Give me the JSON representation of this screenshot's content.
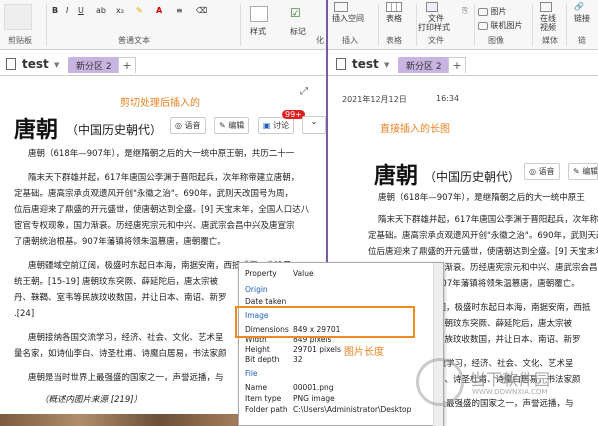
{
  "left_ribbon": {
    "clipboard": "剪贴板",
    "font_group": "普通文本",
    "styles": "样式",
    "tags": "标记",
    "last_cut": "化"
  },
  "right_ribbon": {
    "insert_space": "插入空间",
    "table": "表格",
    "file_printout": "文件\n打印样式",
    "file_printout_l1": "文件",
    "file_printout_l2": "打印样式",
    "picture": "图片",
    "online_picture": "联机图片",
    "online_video": "在线\n视频",
    "online_video_l1": "在线",
    "online_video_l2": "视频",
    "link": "链接",
    "groups": {
      "insert": "插入",
      "tables": "表格",
      "file": "文件",
      "images": "图像",
      "media": "媒体",
      "links": "链"
    }
  },
  "tabs": {
    "notebook": "test",
    "section": "新分区 2",
    "add": "+"
  },
  "left_page": {
    "annotation": "剪切处理后插入的",
    "title": "唐朝",
    "subtitle": "（中国历史朝代）",
    "btn_audio": "语音",
    "btn_edit": "编辑",
    "btn_discuss": "讨论",
    "badge": "99+",
    "lines": [
      "唐朝（618年—907年），是继隋朝之后的大一统中原王朝，共历二十一",
      "隋末天下群雄并起，617年唐国公李渊于晋阳起兵，次年称帝建立唐朝，",
      "定基础。唐高宗承贞观遗风开创\"永徽之治\"。690年，武则天改国号为周，",
      "位后唐迎来了鼎盛的开元盛世，使唐朝达到全盛。[9]  天宝末年，全国人口达八",
      "宦官专权现象，国力渐衰。历经唐宪宗元和中兴、唐武宗会昌中兴及唐宣宗",
      "了唐朝统治根基。907年藩镇将领朱温篡唐，唐朝覆亡。",
      "唐朝疆域空前辽阔，极盛时东起日本海，南据安南，西抵咸海，北逾贝",
      "统王朝。[15-19]  唐朝玟东突厥、薛延陀后，唐太宗被",
      "丹、靺鞨、室韦等民族玟收数国，并让日本、南诏、新罗",
      ".[24]",
      "唐朝接纳各国交流学习，经济、社会、文化、艺术呈",
      "量名家，如诗仙李白、诗圣杜甫、诗魔白居易，书法家颜",
      "唐朝是当时世界上最强盛的国家之一，声誉远播，与",
      "（概述内图片来源 [219]）"
    ]
  },
  "right_page": {
    "date": "2021年12月12日",
    "time": "16:34",
    "annotation": "直接插入的长图",
    "title": "唐朝",
    "subtitle": "（中国历史朝代）",
    "btn_audio": "语音",
    "btn_edit": "编辑",
    "annotation2": "图片长度",
    "lines": [
      "唐朝（618年—907年），是继隋朝之后的大一统中原王",
      "隋末天下群雄并起，617年唐国公李渊于晋阳起兵，次年称帝建",
      "定基础。唐高宗承贞观遗风开创\"永徽之治\"。690年，武则天改国",
      "位后唐迎来了鼎盛的开元盛世，使唐朝达到全盛。[9]  天宝末年，全",
      "宦官专权现象，国力渐衰。历经唐宪宗元和中兴、唐武宗会昌中兴",
      "了唐朝统治根基。907年藩镇将领朱温篡唐，唐朝覆亡。",
      "唐朝疆域空前辽阔，极盛时东起日本海，南据安南，西抵",
      "统王朝。[15-19]  唐朝玟东突厥、薛延陀后，唐太宗被",
      "丹、靺鞨、室韦等民族玟收数国，并让日本、南诏、新罗",
      "唐朝接纳各国交流学习，经济、社会、文化、艺术呈",
      "量名家，如诗仙李白、诗圣杜甫、诗魔白居易，书法家颜",
      "唐朝是当时世界上最强盛的国家之一，声誉远播，与"
    ]
  },
  "properties": {
    "col_property": "Property",
    "col_value": "Value",
    "origin": "Origin",
    "date_taken": "Date taken",
    "image": "Image",
    "dimensions_label": "Dimensions",
    "dimensions_value": "849 x 29701",
    "width_label": "Width",
    "width_value": "849 pixels",
    "height_label": "Height",
    "height_value": "29701 pixels",
    "bitdepth_label": "Bit depth",
    "bitdepth_value": "32",
    "file": "File",
    "name_label": "Name",
    "name_value": "00001.png",
    "itemtype_label": "Item type",
    "itemtype_value": "PNG image",
    "folder_label": "Folder path",
    "folder_value": "C:\\Users\\Administrator\\Desktop"
  },
  "watermark": {
    "text": "当下软件园",
    "sub": "WWW.DOWNXIA.COM"
  },
  "colors": {
    "accent_purple": "#7a5aa0",
    "section_tab": "#c8b4e0",
    "annotation_orange": "#e8821e",
    "link_blue": "#1b5fb8"
  }
}
